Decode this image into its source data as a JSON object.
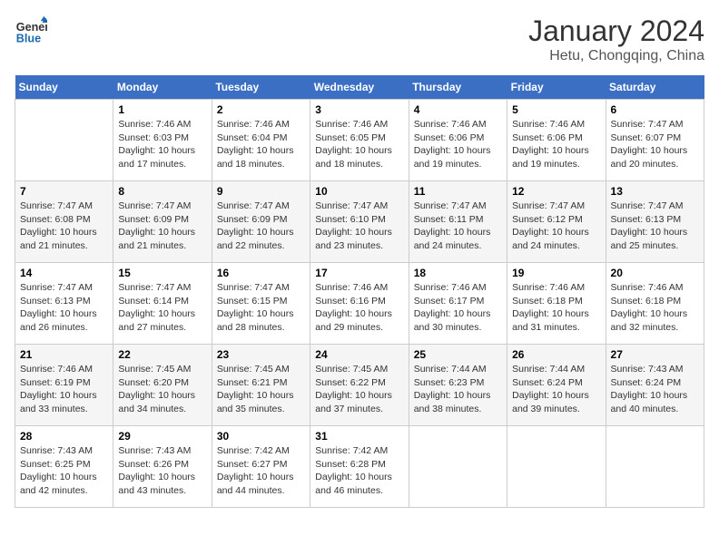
{
  "header": {
    "logo_line1": "General",
    "logo_line2": "Blue",
    "month": "January 2024",
    "location": "Hetu, Chongqing, China"
  },
  "weekdays": [
    "Sunday",
    "Monday",
    "Tuesday",
    "Wednesday",
    "Thursday",
    "Friday",
    "Saturday"
  ],
  "weeks": [
    [
      {
        "day": "",
        "sunrise": "",
        "sunset": "",
        "daylight": ""
      },
      {
        "day": "1",
        "sunrise": "7:46 AM",
        "sunset": "6:03 PM",
        "daylight": "10 hours and 17 minutes."
      },
      {
        "day": "2",
        "sunrise": "7:46 AM",
        "sunset": "6:04 PM",
        "daylight": "10 hours and 18 minutes."
      },
      {
        "day": "3",
        "sunrise": "7:46 AM",
        "sunset": "6:05 PM",
        "daylight": "10 hours and 18 minutes."
      },
      {
        "day": "4",
        "sunrise": "7:46 AM",
        "sunset": "6:06 PM",
        "daylight": "10 hours and 19 minutes."
      },
      {
        "day": "5",
        "sunrise": "7:46 AM",
        "sunset": "6:06 PM",
        "daylight": "10 hours and 19 minutes."
      },
      {
        "day": "6",
        "sunrise": "7:47 AM",
        "sunset": "6:07 PM",
        "daylight": "10 hours and 20 minutes."
      }
    ],
    [
      {
        "day": "7",
        "sunrise": "7:47 AM",
        "sunset": "6:08 PM",
        "daylight": "10 hours and 21 minutes."
      },
      {
        "day": "8",
        "sunrise": "7:47 AM",
        "sunset": "6:09 PM",
        "daylight": "10 hours and 21 minutes."
      },
      {
        "day": "9",
        "sunrise": "7:47 AM",
        "sunset": "6:09 PM",
        "daylight": "10 hours and 22 minutes."
      },
      {
        "day": "10",
        "sunrise": "7:47 AM",
        "sunset": "6:10 PM",
        "daylight": "10 hours and 23 minutes."
      },
      {
        "day": "11",
        "sunrise": "7:47 AM",
        "sunset": "6:11 PM",
        "daylight": "10 hours and 24 minutes."
      },
      {
        "day": "12",
        "sunrise": "7:47 AM",
        "sunset": "6:12 PM",
        "daylight": "10 hours and 24 minutes."
      },
      {
        "day": "13",
        "sunrise": "7:47 AM",
        "sunset": "6:13 PM",
        "daylight": "10 hours and 25 minutes."
      }
    ],
    [
      {
        "day": "14",
        "sunrise": "7:47 AM",
        "sunset": "6:13 PM",
        "daylight": "10 hours and 26 minutes."
      },
      {
        "day": "15",
        "sunrise": "7:47 AM",
        "sunset": "6:14 PM",
        "daylight": "10 hours and 27 minutes."
      },
      {
        "day": "16",
        "sunrise": "7:47 AM",
        "sunset": "6:15 PM",
        "daylight": "10 hours and 28 minutes."
      },
      {
        "day": "17",
        "sunrise": "7:46 AM",
        "sunset": "6:16 PM",
        "daylight": "10 hours and 29 minutes."
      },
      {
        "day": "18",
        "sunrise": "7:46 AM",
        "sunset": "6:17 PM",
        "daylight": "10 hours and 30 minutes."
      },
      {
        "day": "19",
        "sunrise": "7:46 AM",
        "sunset": "6:18 PM",
        "daylight": "10 hours and 31 minutes."
      },
      {
        "day": "20",
        "sunrise": "7:46 AM",
        "sunset": "6:18 PM",
        "daylight": "10 hours and 32 minutes."
      }
    ],
    [
      {
        "day": "21",
        "sunrise": "7:46 AM",
        "sunset": "6:19 PM",
        "daylight": "10 hours and 33 minutes."
      },
      {
        "day": "22",
        "sunrise": "7:45 AM",
        "sunset": "6:20 PM",
        "daylight": "10 hours and 34 minutes."
      },
      {
        "day": "23",
        "sunrise": "7:45 AM",
        "sunset": "6:21 PM",
        "daylight": "10 hours and 35 minutes."
      },
      {
        "day": "24",
        "sunrise": "7:45 AM",
        "sunset": "6:22 PM",
        "daylight": "10 hours and 37 minutes."
      },
      {
        "day": "25",
        "sunrise": "7:44 AM",
        "sunset": "6:23 PM",
        "daylight": "10 hours and 38 minutes."
      },
      {
        "day": "26",
        "sunrise": "7:44 AM",
        "sunset": "6:24 PM",
        "daylight": "10 hours and 39 minutes."
      },
      {
        "day": "27",
        "sunrise": "7:43 AM",
        "sunset": "6:24 PM",
        "daylight": "10 hours and 40 minutes."
      }
    ],
    [
      {
        "day": "28",
        "sunrise": "7:43 AM",
        "sunset": "6:25 PM",
        "daylight": "10 hours and 42 minutes."
      },
      {
        "day": "29",
        "sunrise": "7:43 AM",
        "sunset": "6:26 PM",
        "daylight": "10 hours and 43 minutes."
      },
      {
        "day": "30",
        "sunrise": "7:42 AM",
        "sunset": "6:27 PM",
        "daylight": "10 hours and 44 minutes."
      },
      {
        "day": "31",
        "sunrise": "7:42 AM",
        "sunset": "6:28 PM",
        "daylight": "10 hours and 46 minutes."
      },
      {
        "day": "",
        "sunrise": "",
        "sunset": "",
        "daylight": ""
      },
      {
        "day": "",
        "sunrise": "",
        "sunset": "",
        "daylight": ""
      },
      {
        "day": "",
        "sunrise": "",
        "sunset": "",
        "daylight": ""
      }
    ]
  ],
  "labels": {
    "sunrise_prefix": "Sunrise: ",
    "sunset_prefix": "Sunset: ",
    "daylight_prefix": "Daylight: "
  }
}
